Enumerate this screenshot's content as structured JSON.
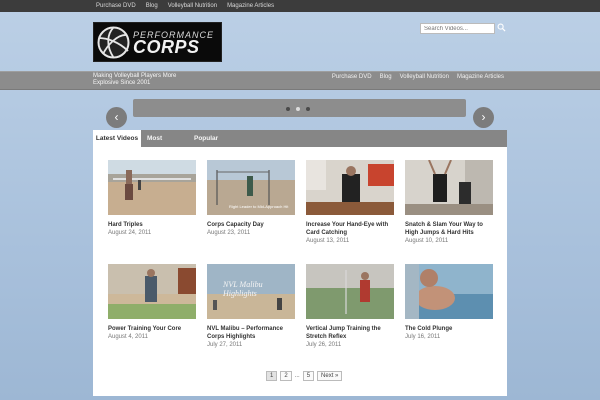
{
  "top_nav": [
    "Purchase DVD",
    "Blog",
    "Volleyball Nutrition",
    "Magazine Articles"
  ],
  "logo": {
    "line1": "PERFORMANCE",
    "line2": "CORPS"
  },
  "search": {
    "placeholder": "Search Videos..."
  },
  "tagline": "Making Volleyball Players More Explosive Since 2001",
  "main_nav": [
    "Purchase DVD",
    "Blog",
    "Volleyball Nutrition",
    "Magazine Articles"
  ],
  "slider": {
    "dots": 3,
    "active_dot": 1
  },
  "arrows": {
    "prev": "‹",
    "next": "›"
  },
  "tabs": [
    "Latest Videos",
    "Most Popular",
    "Popular Keywords"
  ],
  "videos": [
    {
      "title": "Hard Triples",
      "date": "August 24, 2011"
    },
    {
      "title": "Corps Capacity Day",
      "date": "August 23, 2011",
      "overlay": "Right Leader to Mid-Approach Hit"
    },
    {
      "title": "Increase Your Hand-Eye with Card Catching",
      "date": "August 13, 2011"
    },
    {
      "title": "Snatch & Slam Your Way to High Jumps & Hard Hits",
      "date": "August 10, 2011"
    },
    {
      "title": "Power Training Your Core",
      "date": "August 4, 2011"
    },
    {
      "title": "NVL Malibu – Performance Corps Highlights",
      "date": "July 27, 2011",
      "overlay": "NVL Malibu Highlights"
    },
    {
      "title": "Vertical Jump Training the Stretch Reflex",
      "date": "July 26, 2011"
    },
    {
      "title": "The Cold Plunge",
      "date": "July 16, 2011"
    }
  ],
  "pagination": {
    "pages": [
      "1",
      "2",
      "5"
    ],
    "ellipsis": "...",
    "next": "Next »",
    "current": "1"
  },
  "colors": {
    "topbar": "#3c3c3c",
    "navbar": "#8c8c8c",
    "background": "#bcd0e6",
    "panel": "#ffffff"
  }
}
